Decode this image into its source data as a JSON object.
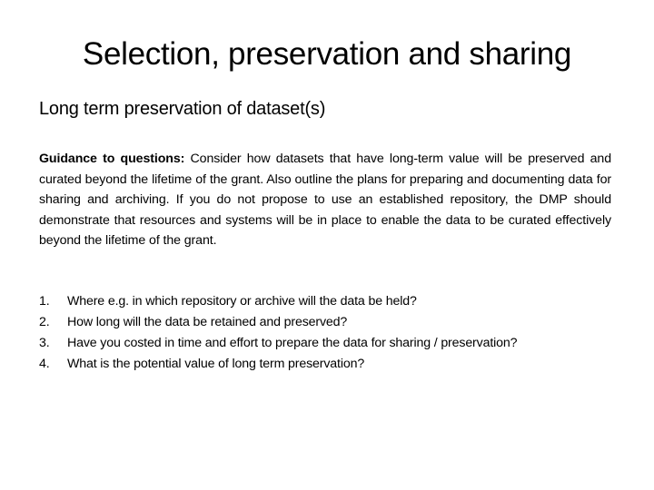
{
  "slide": {
    "title": "Selection, preservation and sharing",
    "subtitle": "Long term preservation of dataset(s)",
    "guidance": {
      "label": "Guidance to questions:",
      "text": " Consider how datasets that have long-term value will be preserved and curated beyond the lifetime of the grant. Also outline the plans for preparing and documenting data for sharing and archiving. If you do not propose to use an established repository, the DMP should demonstrate that resources and systems will be in place to enable the data to be curated effectively beyond the lifetime of the grant."
    },
    "questions": [
      {
        "num": "1.",
        "text": "Where e.g. in which repository or archive will the data be held?"
      },
      {
        "num": "2.",
        "text": "How long will the data be retained and preserved?"
      },
      {
        "num": "3.",
        "text": "Have you costed in time and effort to prepare the data for sharing / preservation?"
      },
      {
        "num": "4.",
        "text": "What is the potential value of long term preservation?"
      }
    ]
  }
}
